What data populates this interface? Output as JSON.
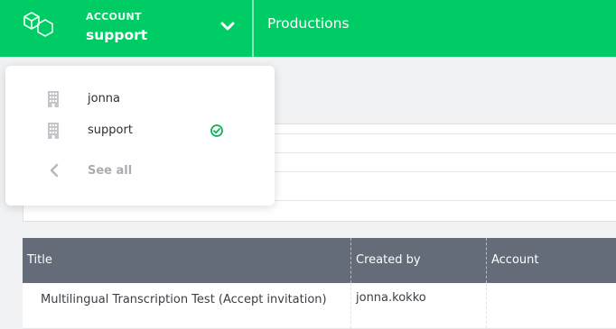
{
  "header": {
    "account_label": "ACCOUNT",
    "account_name": "support",
    "nav_productions": "Productions",
    "brand_color": "#00cc66",
    "icons": {
      "logo": "hexagon-cubes-logo-icon",
      "toggle": "chevron-down-icon"
    }
  },
  "account_dropdown": {
    "items": [
      {
        "label": "jonna",
        "icon": "building-icon",
        "selected": false
      },
      {
        "label": "support",
        "icon": "building-icon",
        "selected": true
      }
    ],
    "selected_icon": "check-circle-icon",
    "see_all": {
      "label": "See all",
      "icon": "chevron-left-icon"
    }
  },
  "table": {
    "columns": [
      "Title",
      "Created by",
      "Account"
    ],
    "rows": [
      {
        "title": "Multilingual Transcription Test (Accept invitation)",
        "created_by": "jonna.kokko",
        "account": ""
      }
    ],
    "header_color": "#636c78"
  }
}
